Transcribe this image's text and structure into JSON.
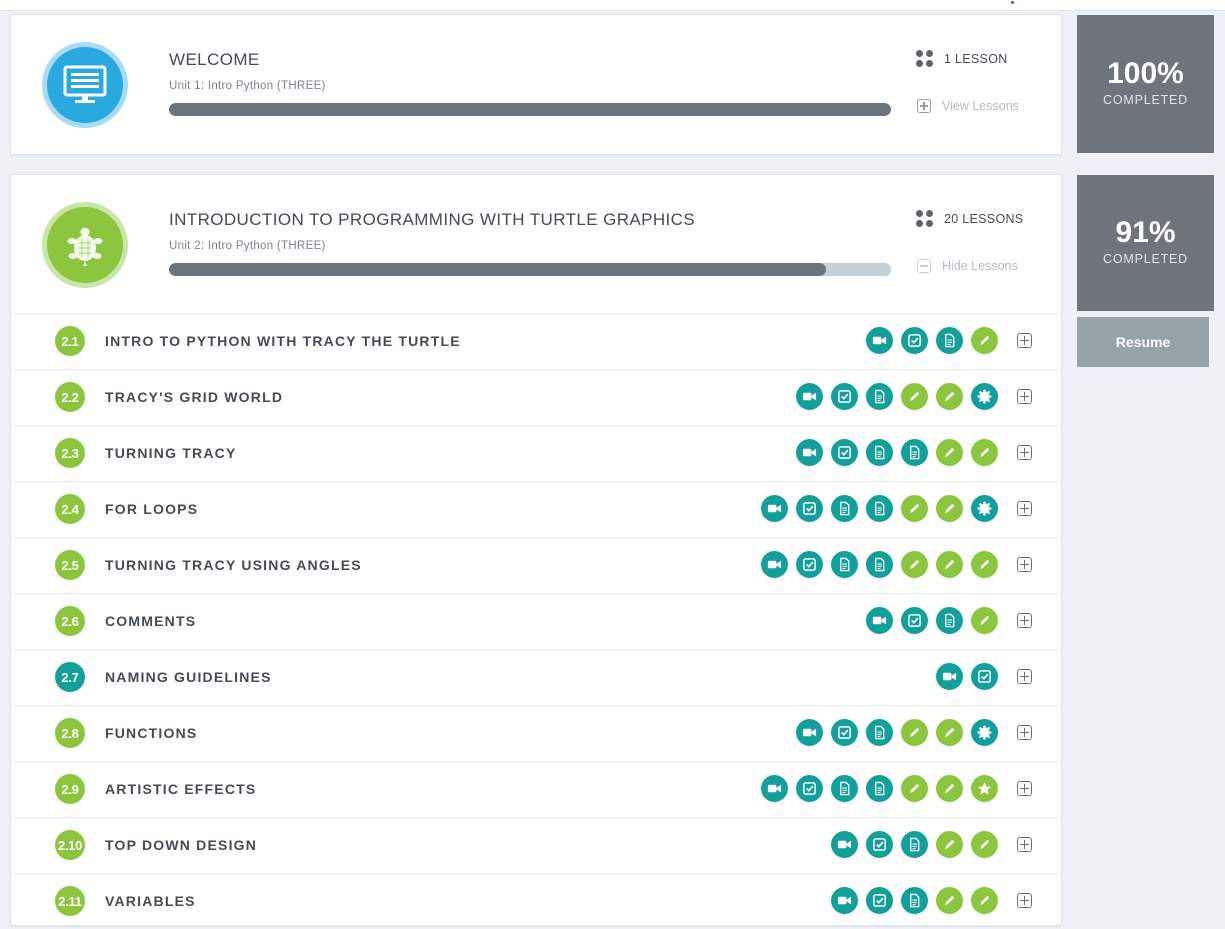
{
  "units": [
    {
      "title": "WELCOME",
      "subtitle": "Unit 1: Intro Python (THREE)",
      "lesson_count": "1 LESSON",
      "toggle_label": "View Lessons",
      "progress_fraction": 1.0,
      "percent": "100%",
      "completed_label": "COMPLETED",
      "icon": "monitor-icon",
      "color": "#2aa9e0"
    },
    {
      "title": "INTRODUCTION TO PROGRAMMING WITH TURTLE GRAPHICS",
      "subtitle": "Unit 2: Intro Python (THREE)",
      "lesson_count": "20 LESSONS",
      "toggle_label": "Hide Lessons",
      "progress_fraction": 0.91,
      "percent": "91%",
      "completed_label": "COMPLETED",
      "resume_label": "Resume",
      "icon": "turtle-icon",
      "color": "#8cc63f"
    }
  ],
  "lessons": [
    {
      "num": "2.1",
      "title": "INTRO TO PYTHON WITH TRACY THE TURTLE",
      "badge": "green",
      "activities": [
        "video",
        "quiz",
        "doc",
        "exercise"
      ]
    },
    {
      "num": "2.2",
      "title": "TRACY'S GRID WORLD",
      "badge": "green",
      "activities": [
        "video",
        "quiz",
        "doc",
        "exercise",
        "exercise",
        "badge"
      ]
    },
    {
      "num": "2.3",
      "title": "TURNING TRACY",
      "badge": "green",
      "activities": [
        "video",
        "quiz",
        "doc",
        "doc",
        "exercise",
        "exercise"
      ]
    },
    {
      "num": "2.4",
      "title": "FOR LOOPS",
      "badge": "green",
      "activities": [
        "video",
        "quiz",
        "doc",
        "doc",
        "exercise",
        "exercise",
        "badge"
      ]
    },
    {
      "num": "2.5",
      "title": "TURNING TRACY USING ANGLES",
      "badge": "green",
      "activities": [
        "video",
        "quiz",
        "doc",
        "doc",
        "exercise",
        "exercise",
        "exercise"
      ]
    },
    {
      "num": "2.6",
      "title": "COMMENTS",
      "badge": "green",
      "activities": [
        "video",
        "quiz",
        "doc",
        "exercise"
      ]
    },
    {
      "num": "2.7",
      "title": "NAMING GUIDELINES",
      "badge": "teal",
      "activities": [
        "video",
        "quiz"
      ]
    },
    {
      "num": "2.8",
      "title": "FUNCTIONS",
      "badge": "green",
      "activities": [
        "video",
        "quiz",
        "doc",
        "exercise",
        "exercise",
        "badge"
      ]
    },
    {
      "num": "2.9",
      "title": "ARTISTIC EFFECTS",
      "badge": "green",
      "activities": [
        "video",
        "quiz",
        "doc",
        "doc",
        "exercise",
        "exercise",
        "star"
      ]
    },
    {
      "num": "2.10",
      "title": "TOP DOWN DESIGN",
      "badge": "green",
      "activities": [
        "video",
        "quiz",
        "doc",
        "exercise",
        "exercise"
      ]
    },
    {
      "num": "2.11",
      "title": "VARIABLES",
      "badge": "green",
      "activities": [
        "video",
        "quiz",
        "doc",
        "exercise",
        "exercise"
      ]
    }
  ],
  "activity_colors": {
    "video": "teal",
    "quiz": "teal",
    "doc": "teal",
    "badge": "teal",
    "exercise": "green",
    "star": "green"
  }
}
